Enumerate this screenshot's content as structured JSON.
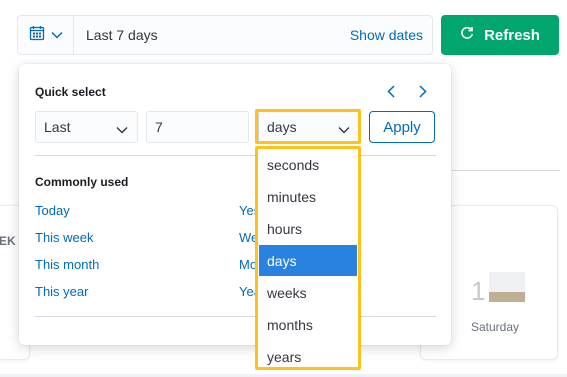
{
  "date_picker": {
    "range_text": "Last 7 days",
    "show_dates_label": "Show dates",
    "calendar_icon": "calendar-icon",
    "dropdown_icon": "chevron-down-icon"
  },
  "refresh": {
    "label": "Refresh",
    "icon": "refresh-icon",
    "color": "#00a66e"
  },
  "quick_select": {
    "title": "Quick select",
    "tense_value": "Last",
    "amount_value": "7",
    "unit_value": "days",
    "apply_label": "Apply",
    "prev_icon": "chevron-left-icon",
    "next_icon": "chevron-right-icon"
  },
  "commonly_used": {
    "title": "Commonly used",
    "left_items": [
      "Today",
      "This week",
      "This month",
      "This year"
    ],
    "right_items_partial": [
      "Yes",
      "We",
      "Mo",
      "Yea"
    ]
  },
  "unit_dropdown": {
    "options": [
      "seconds",
      "minutes",
      "hours",
      "days",
      "weeks",
      "months",
      "years"
    ],
    "selected": "days",
    "highlight_color": "#ffc21a",
    "selected_color": "#2a82e0"
  },
  "background": {
    "left_card_text": "EK",
    "right_card_digit": "1",
    "right_card_day": "Saturday"
  }
}
